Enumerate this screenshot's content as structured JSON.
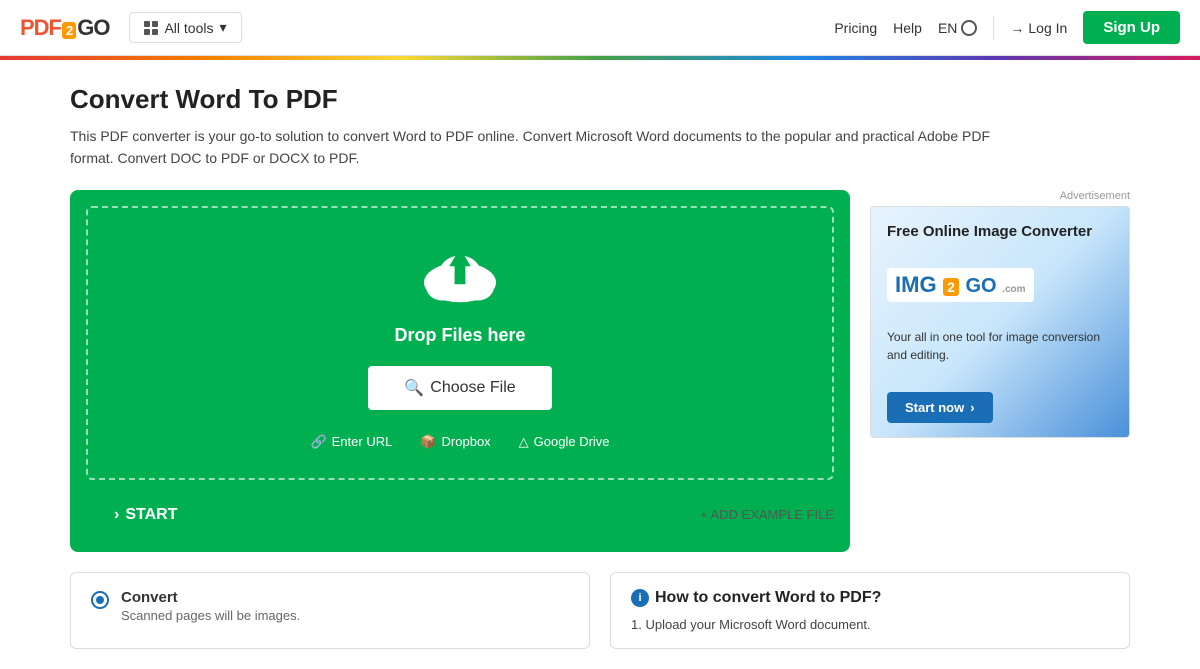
{
  "header": {
    "logo": {
      "prefix": "PDF",
      "box": "2",
      "suffix": "GO"
    },
    "all_tools_label": "All tools",
    "nav_links": [
      "Pricing",
      "Help"
    ],
    "lang": "EN",
    "login_label": "Log In",
    "signup_label": "Sign Up"
  },
  "page": {
    "title": "Convert Word To PDF",
    "description": "This PDF converter is your go-to solution to convert Word to PDF online. Convert Microsoft Word documents to the popular and practical Adobe PDF format. Convert DOC to PDF or DOCX to PDF."
  },
  "upload": {
    "drop_text": "Drop Files here",
    "choose_file_label": "Choose File",
    "options": [
      {
        "label": "Enter URL",
        "icon": "link"
      },
      {
        "label": "Dropbox",
        "icon": "dropbox"
      },
      {
        "label": "Google Drive",
        "icon": "google-drive"
      }
    ]
  },
  "actions": {
    "start_label": "START",
    "add_example_label": "+ ADD EXAMPLE FILE"
  },
  "ad": {
    "label": "Advertisement",
    "headline": "Free Online Image Converter",
    "logo_text": "IMG",
    "logo_num": "2",
    "logo_suffix": "GO",
    "sub_text": "Your all in one tool for image conversion and editing.",
    "cta_label": "Start now"
  },
  "convert_panel": {
    "label": "Convert",
    "sub_label": "Scanned pages will be images."
  },
  "howto": {
    "title": "How to convert Word to PDF?",
    "step1": "1. Upload your Microsoft Word document."
  }
}
